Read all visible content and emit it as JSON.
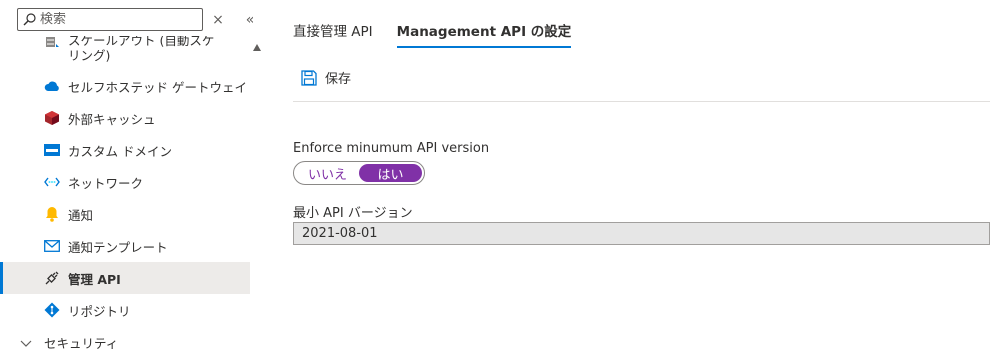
{
  "sidebar": {
    "search_placeholder": "検索",
    "close_glyph": "×",
    "collapse_glyph": "«",
    "partial_item_text": "スケールアウト (自動スケ\nリング)",
    "items": [
      {
        "label": "セルフホステッド ゲートウェイ",
        "icon": "cloud-gateway-icon"
      },
      {
        "label": "外部キャッシュ",
        "icon": "cache-cube-icon"
      },
      {
        "label": "カスタム ドメイン",
        "icon": "custom-domain-icon"
      },
      {
        "label": "ネットワーク",
        "icon": "network-icon"
      },
      {
        "label": "通知",
        "icon": "bell-icon"
      },
      {
        "label": "通知テンプレート",
        "icon": "mail-icon"
      },
      {
        "label": "管理 API",
        "icon": "plug-icon"
      },
      {
        "label": "リポジトリ",
        "icon": "git-icon"
      }
    ],
    "group": {
      "label": "セキュリティ"
    }
  },
  "main": {
    "tabs": [
      {
        "label": "直接管理 API"
      },
      {
        "label": "Management API の設定"
      }
    ],
    "toolbar": {
      "save_label": "保存"
    },
    "enforce": {
      "label": "Enforce minumum API version",
      "off_label": "いいえ",
      "on_label": "はい",
      "selected": "はい"
    },
    "min_version": {
      "label": "最小 API バージョン",
      "value": "2021-08-01"
    }
  },
  "colors": {
    "accent": "#0078d4",
    "toggle_on": "#8031a7",
    "selected_bg": "#edebe9"
  }
}
